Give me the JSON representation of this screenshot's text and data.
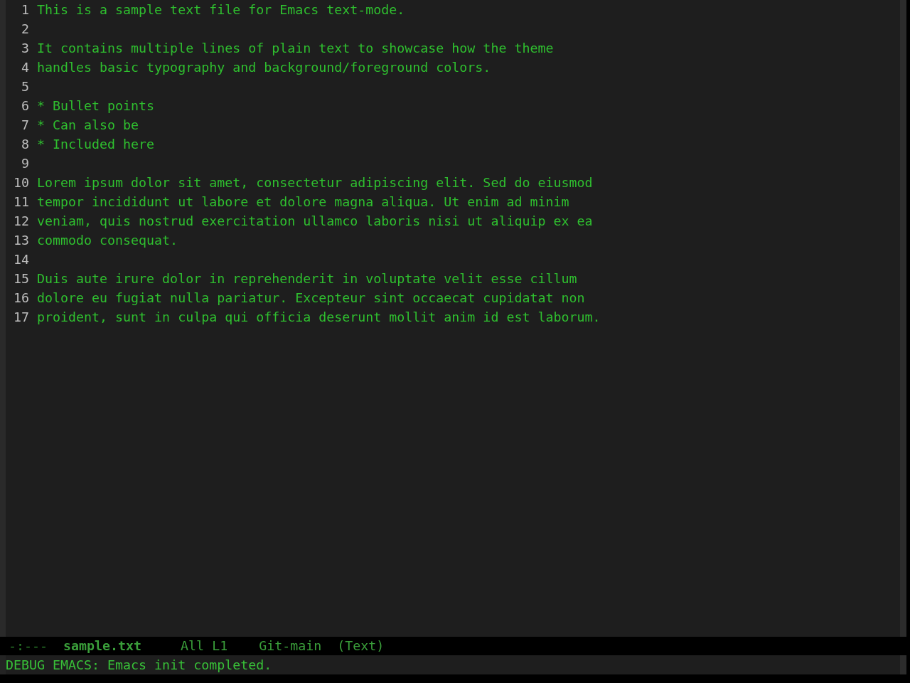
{
  "editor": {
    "lines": [
      {
        "number": "1",
        "text": "This is a sample text file for Emacs text-mode."
      },
      {
        "number": "2"
      },
      {
        "number": "3",
        "text": "It contains multiple lines of plain text to showcase how the theme"
      },
      {
        "number": "4",
        "text": "handles basic typography and background/foreground colors."
      },
      {
        "number": "5"
      },
      {
        "number": "6",
        "text": "* Bullet points"
      },
      {
        "number": "7",
        "text": "* Can also be"
      },
      {
        "number": "8",
        "text": "* Included here"
      },
      {
        "number": "9"
      },
      {
        "number": "10",
        "text": "Lorem ipsum dolor sit amet, consectetur adipiscing elit. Sed do eiusmod"
      },
      {
        "number": "11",
        "text": "tempor incididunt ut labore et dolore magna aliqua. Ut enim ad minim"
      },
      {
        "number": "12",
        "text": "veniam, quis nostrud exercitation ullamco laboris nisi ut aliquip ex ea"
      },
      {
        "number": "13",
        "text": "commodo consequat."
      },
      {
        "number": "14"
      },
      {
        "number": "15",
        "text": "Duis aute irure dolor in reprehenderit in voluptate velit esse cillum"
      },
      {
        "number": "16",
        "text": "dolore eu fugiat nulla pariatur. Excepteur sint occaecat cupidatat non"
      },
      {
        "number": "17",
        "text": "proident, sunt in culpa qui officia deserunt mollit anim id est laborum."
      }
    ]
  },
  "mode_line": [
    {
      "kind": "status",
      "text": "-:---"
    },
    {
      "kind": "buffer",
      "text": "sample.txt"
    },
    {
      "kind": "position",
      "text": "All L1"
    },
    {
      "kind": "vc",
      "text": "Git-main"
    },
    {
      "kind": "mode",
      "text": "(Text)"
    }
  ],
  "echo_area": {
    "message": "DEBUG EMACS: Emacs init completed."
  }
}
